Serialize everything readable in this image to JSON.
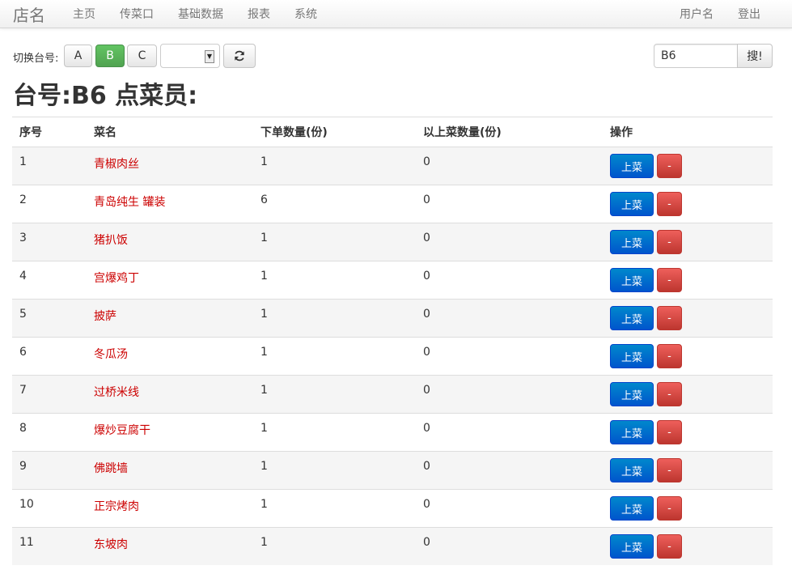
{
  "navbar": {
    "brand": "店名",
    "items": [
      "主页",
      "传菜口",
      "基础数据",
      "报表",
      "系统"
    ],
    "user": "用户名",
    "logout": "登出"
  },
  "toolbar": {
    "switch_label": "切换台号:",
    "table_buttons": [
      "A",
      "B",
      "C"
    ],
    "active_button": "B",
    "select_value": "",
    "refresh_icon": "refresh-icon",
    "search_value": "B6",
    "search_button": "搜!"
  },
  "heading": "台号:B6 点菜员:",
  "table": {
    "headers": [
      "序号",
      "菜名",
      "下单数量(份)",
      "以上菜数量(份)",
      "操作"
    ],
    "rows": [
      [
        "1",
        "青椒肉丝",
        "1",
        "0"
      ],
      [
        "2",
        "青岛纯生 罐装",
        "6",
        "0"
      ],
      [
        "3",
        "猪扒饭",
        "1",
        "0"
      ],
      [
        "4",
        "宫爆鸡丁",
        "1",
        "0"
      ],
      [
        "5",
        "披萨",
        "1",
        "0"
      ],
      [
        "6",
        "冬瓜汤",
        "1",
        "0"
      ],
      [
        "7",
        "过桥米线",
        "1",
        "0"
      ],
      [
        "8",
        "爆炒豆腐干",
        "1",
        "0"
      ],
      [
        "9",
        "佛跳墙",
        "1",
        "0"
      ],
      [
        "10",
        "正宗烤肉",
        "1",
        "0"
      ],
      [
        "11",
        "东坡肉",
        "1",
        "0"
      ]
    ],
    "serve_label": "上菜",
    "remove_label": "-"
  },
  "colors": {
    "dish_name": "#cc0000",
    "serve_button": "#0055cc",
    "remove_button": "#d9534f",
    "active_button": "#51a351"
  }
}
